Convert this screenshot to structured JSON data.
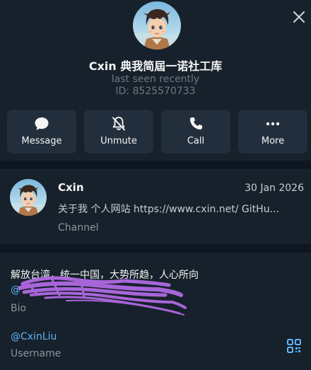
{
  "profile": {
    "name": "Cxin 典我简屆一诺社工库",
    "last_seen": "last seen recently",
    "id_text": "ID: 8525570733",
    "avatar_icon": "anime-boy-avatar"
  },
  "header": {
    "close_icon": "close-icon"
  },
  "actions": [
    {
      "label": "Message",
      "icon": "message-bubble-icon"
    },
    {
      "label": "Unmute",
      "icon": "bell-muted-icon"
    },
    {
      "label": "Call",
      "icon": "phone-icon"
    },
    {
      "label": "More",
      "icon": "more-dots-icon"
    }
  ],
  "channel": {
    "name": "Cxin",
    "date": "30 Jan 2026",
    "description": "关于我 个人网站 https://www.cxin.net/ GitHu...",
    "type": "Channel"
  },
  "bio": {
    "text": "解放台湾，统一中国，大势所趋，人心所向",
    "link_visible": "@",
    "label": "Bio",
    "redaction": "purple-scribble"
  },
  "username": {
    "value": "@CxinLiu",
    "label": "Username",
    "qr_icon": "qr-code-icon"
  },
  "colors": {
    "background": "#17212b",
    "button_bg": "#232e3c",
    "divider": "#0e1621",
    "link": "#5eb5f7",
    "muted": "#6d7883",
    "scribble": "#b56be8"
  }
}
